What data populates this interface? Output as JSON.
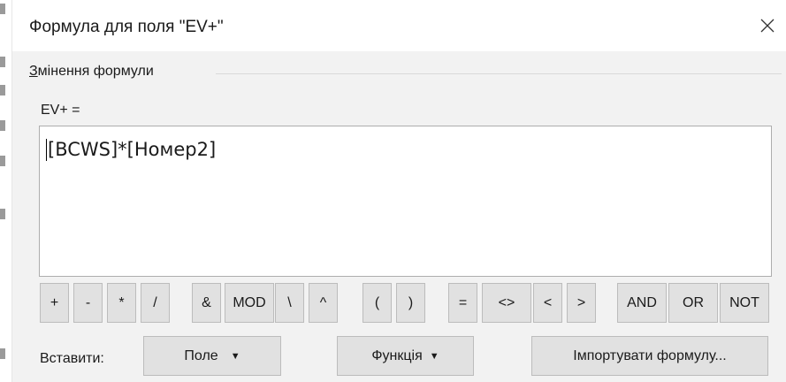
{
  "dialog": {
    "title": "Формула для поля \"EV+\"",
    "close_icon": "close-icon"
  },
  "group": {
    "label_underlined": "З",
    "label_rest": "мінення формули"
  },
  "formula": {
    "label": "EV+ =",
    "value": "[BCWS]*[Номер2]"
  },
  "operators": [
    "+",
    "-",
    "*",
    "/",
    "&",
    "MOD",
    "\\",
    "^",
    "(",
    ")",
    "=",
    "<>",
    "<",
    ">",
    "AND",
    "OR",
    "NOT"
  ],
  "insert": {
    "label": "Вставити:",
    "field_button": "Поле",
    "function_button": "Функція",
    "import_button": "Імпортувати формулу...",
    "dropdown_arrow": "▼"
  }
}
